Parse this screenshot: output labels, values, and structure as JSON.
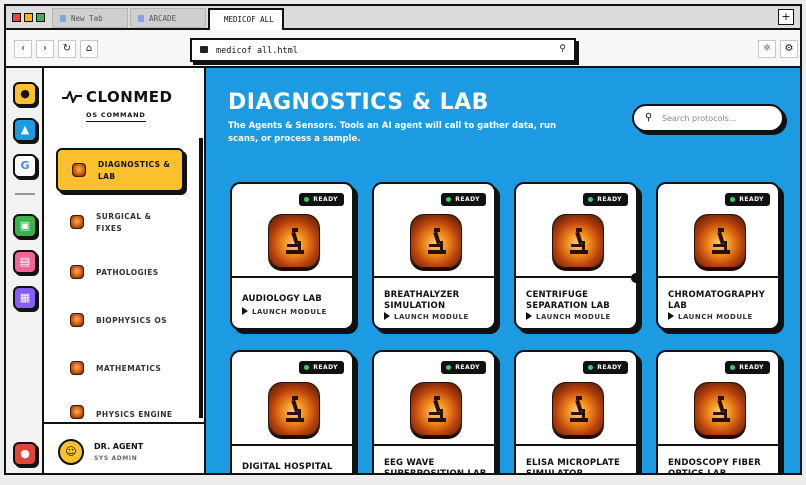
{
  "browser": {
    "tabs": [
      {
        "label": "New Tab"
      },
      {
        "label": "ARCADE"
      },
      {
        "label": "MEDICOF ALL"
      }
    ],
    "new_tab": "+",
    "url": "medicof all.html",
    "traffic_colors": [
      "#e0443a",
      "#f0b429",
      "#37b24d"
    ]
  },
  "rail": {
    "items": [
      {
        "icon": "gamepad-icon",
        "color": "#fbc02d"
      },
      {
        "icon": "graduation-cap-icon",
        "color": "#1d9be2"
      },
      {
        "icon": "google-icon",
        "color": "#ffffff"
      },
      {
        "icon": "document-icon",
        "color": "#37b24d"
      },
      {
        "icon": "file-icon",
        "color": "#f06595"
      },
      {
        "icon": "calendar-icon",
        "color": "#845ef7"
      },
      {
        "icon": "user-icon",
        "color": "#e0443a"
      }
    ]
  },
  "sidebar": {
    "brand": "CLONMED",
    "subtitle": "OS COMMAND",
    "items": [
      {
        "label": "DIAGNOSTICS & LAB",
        "active": true
      },
      {
        "label": "SURGICAL & FIXES"
      },
      {
        "label": "PATHOLOGIES"
      },
      {
        "label": "BIOPHYSICS OS"
      },
      {
        "label": "MATHEMATICS"
      },
      {
        "label": "PHYSICS ENGINE"
      }
    ],
    "user": {
      "name": "DR. AGENT",
      "role": "SYS ADMIN"
    }
  },
  "main": {
    "title": "DIAGNOSTICS & LAB",
    "description": "The Agents & Sensors. Tools an AI agent will call to gather data, run scans, or process a sample.",
    "search_placeholder": "Search protocols...",
    "badge": "READY",
    "launch": "LAUNCH MODULE",
    "cards": [
      {
        "title": "AUDIOLOGY LAB"
      },
      {
        "title": "BREATHALYZER SIMULATION"
      },
      {
        "title": "CENTRIFUGE SEPARATION LAB"
      },
      {
        "title": "CHROMATOGRAPHY LAB"
      },
      {
        "title": "DIGITAL HOSPITAL"
      },
      {
        "title": "EEG WAVE SUPERPOSITION LAB"
      },
      {
        "title": "ELISA MICROPLATE SIMULATOR"
      },
      {
        "title": "ENDOSCOPY FIBER OPTICS LAB"
      }
    ]
  },
  "colors": {
    "accent_yellow": "#fbc02d",
    "main_blue": "#1d9be2",
    "ready_dot": "#3ccb6b"
  }
}
